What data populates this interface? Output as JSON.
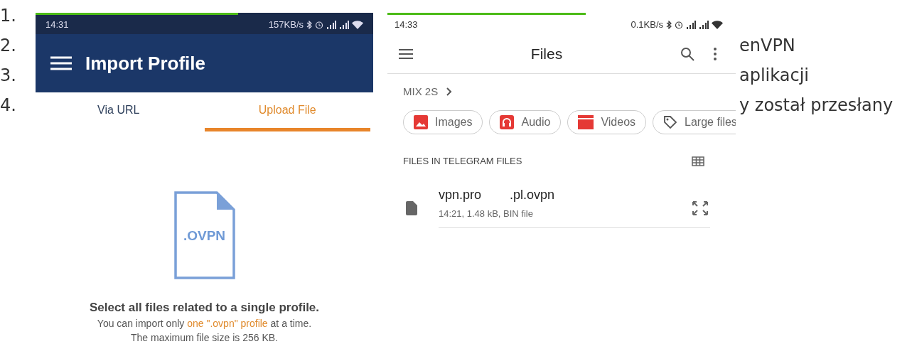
{
  "list": [
    {
      "number": "1."
    },
    {
      "number": "2.",
      "tail": "enVPN"
    },
    {
      "number": "3.",
      "tail": "aplikacji"
    },
    {
      "number": "4.",
      "tail": "y został przesłany"
    }
  ],
  "import_screen": {
    "loading_bar": {
      "level": 0.6
    },
    "status_bar": {
      "time": "14:31",
      "speed": "157KB/s"
    },
    "title": "Import Profile",
    "tabs": [
      {
        "label": "Via URL",
        "selected": false
      },
      {
        "label": "Upload File",
        "selected": true
      }
    ],
    "file_badge": ".OVPN",
    "heading": "Select all files related to a single profile.",
    "note": {
      "before": "You can import only ",
      "highlight": "one \".ovpn\" profile",
      "after": " at a time."
    },
    "limit": "The maximum file size is 256 KB."
  },
  "files_screen": {
    "loading_bar": {
      "level": 0.57
    },
    "status_bar": {
      "time": "14:33",
      "speed": "0.1KB/s"
    },
    "title": "Files",
    "breadcrumb": "MIX 2S",
    "chips": [
      {
        "kind": "images",
        "label": "Images"
      },
      {
        "kind": "audio",
        "label": "Audio"
      },
      {
        "kind": "videos",
        "label": "Videos"
      },
      {
        "kind": "large",
        "label": "Large files"
      }
    ],
    "section": "FILES IN TELEGRAM FILES",
    "files": [
      {
        "name": "vpn.pro        .pl.ovpn",
        "meta": "14:21, 1.48 kB, BIN file"
      }
    ]
  }
}
